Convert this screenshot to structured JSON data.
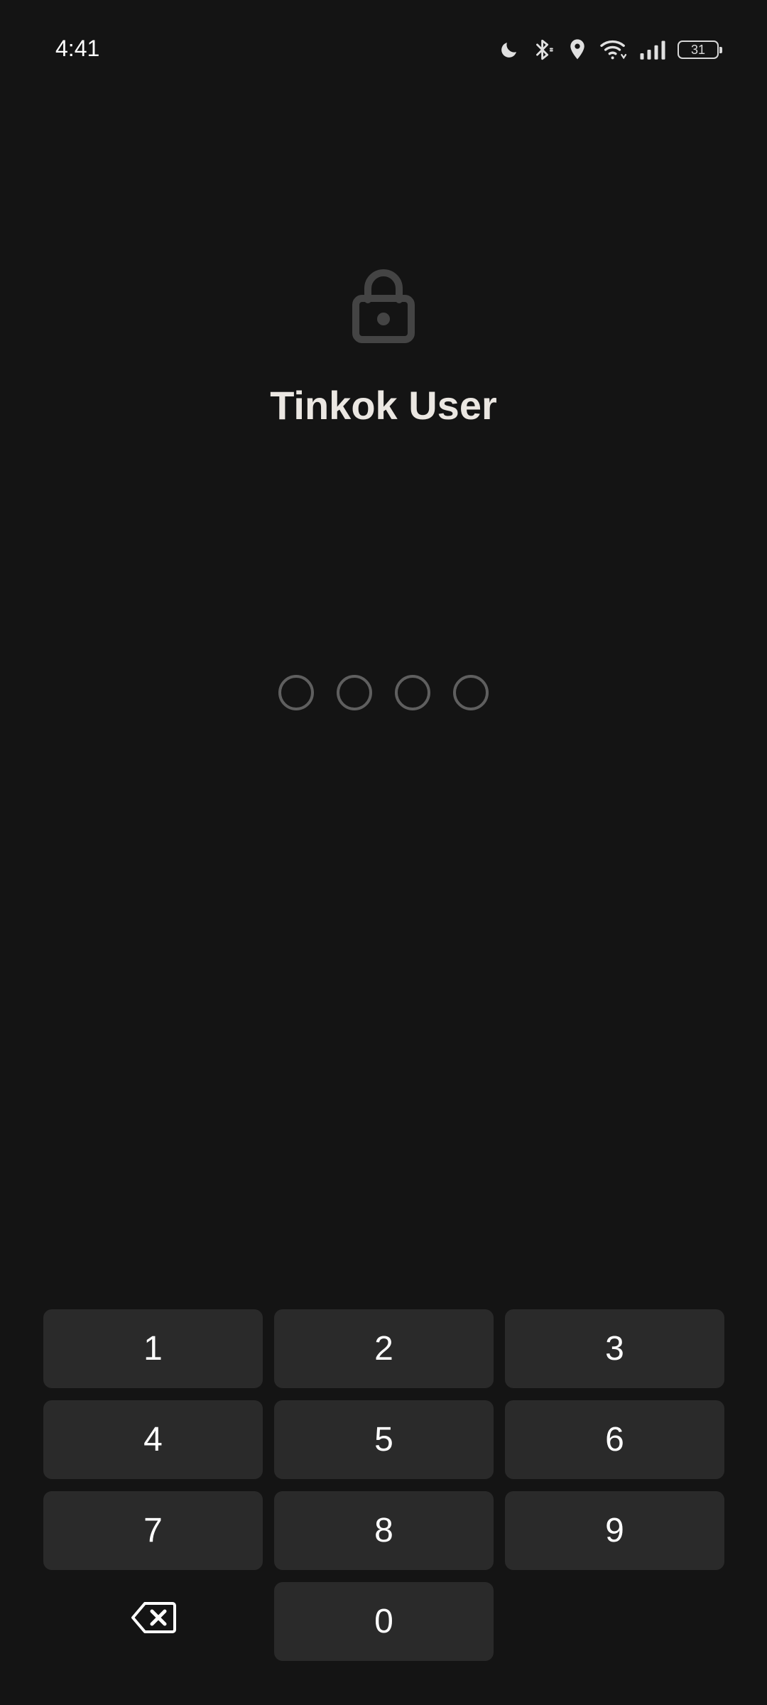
{
  "status_bar": {
    "time": "4:41",
    "icons": [
      "moon-icon",
      "bluetooth-icon",
      "location-icon",
      "wifi-icon",
      "signal-icon",
      "battery-icon"
    ],
    "battery_level": "31"
  },
  "lock_screen": {
    "icon": "lock-icon",
    "user_name": "Tinkok User",
    "pin_length": 4,
    "pin_entered": 0
  },
  "keypad": {
    "keys": [
      "1",
      "2",
      "3",
      "4",
      "5",
      "6",
      "7",
      "8",
      "9",
      "0"
    ],
    "backspace_icon": "backspace-icon"
  },
  "colors": {
    "background": "#141414",
    "key_background": "#2a2a2a",
    "title_text": "#ebe7e2",
    "pin_dot_outline": "#5f5f5f",
    "lock_icon": "#444444"
  }
}
